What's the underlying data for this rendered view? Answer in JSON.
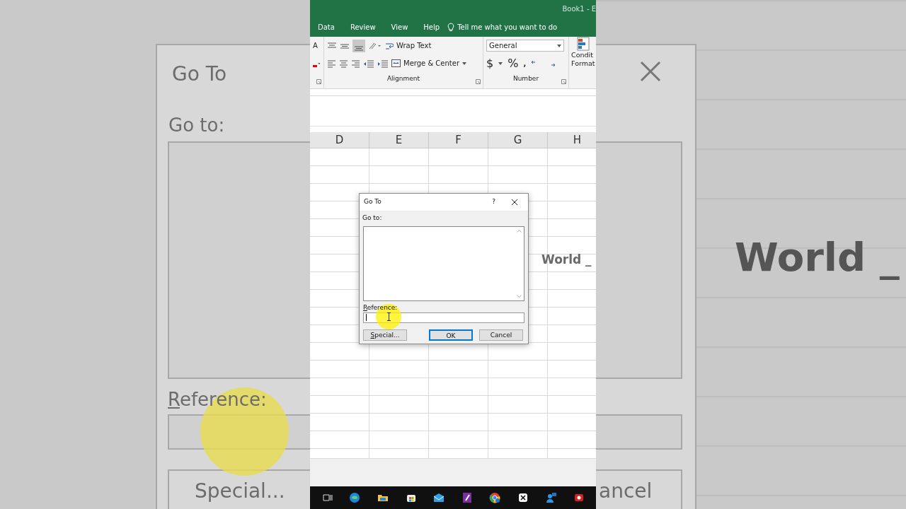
{
  "title_bar": {
    "document_title": "Book1 - E"
  },
  "ribbon_tabs": [
    {
      "label": "Data"
    },
    {
      "label": "Review"
    },
    {
      "label": "View"
    },
    {
      "label": "Help"
    }
  ],
  "tell_me": {
    "label": "Tell me what you want to do"
  },
  "ribbon": {
    "font_size_label": "A",
    "wrap_text": "Wrap Text",
    "merge_center": "Merge & Center",
    "number_format": "General",
    "currency": "$",
    "percent": "%",
    "comma": ",",
    "conditional_formatting": [
      "Condit",
      "Format"
    ],
    "groups": [
      "Alignment",
      "Number"
    ]
  },
  "sheet": {
    "columns": [
      "D",
      "E",
      "F",
      "G",
      "H"
    ],
    "cell_text": "World _"
  },
  "dialog": {
    "title": "Go To",
    "help": "?",
    "list_label": "Go to:",
    "reference_label": "Reference:",
    "buttons": [
      {
        "label": "Special...",
        "kind": "normal"
      },
      {
        "label": "OK",
        "kind": "default"
      },
      {
        "label": "Cancel",
        "kind": "normal"
      }
    ]
  },
  "backdrop": {
    "left": {
      "title": "Go To",
      "list_label": "Go to:",
      "reference_label": "Reference:",
      "button": "Special..."
    },
    "right": {
      "cell_text": "World _",
      "button": "ancel"
    }
  }
}
